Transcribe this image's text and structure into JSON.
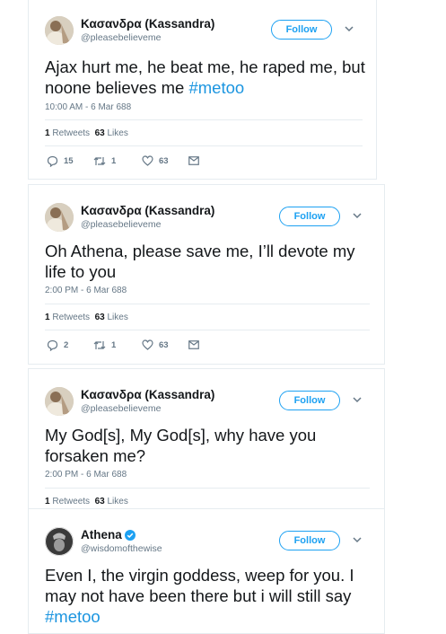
{
  "tweets": [
    {
      "display_name": "Κασανδρα (Kassandra)",
      "handle": "@pleasebelieveme",
      "follow_label": "Follow",
      "text": "Ajax hurt me, he beat me, he raped me, but noone believes me ",
      "hashtag": "#metoo",
      "timestamp": "10:00 AM - 6 Mar 688",
      "retweets_count": "1",
      "retweets_label": "Retweets",
      "likes_count": "63",
      "likes_label": "Likes",
      "reply_count": "15",
      "retweet_action_count": "1",
      "like_action_count": "63"
    },
    {
      "display_name": "Κασανδρα (Kassandra)",
      "handle": "@pleasebelieveme",
      "follow_label": "Follow",
      "text": "Oh Athena, please save me, I’ll devote my life to you",
      "timestamp": "2:00 PM - 6 Mar 688",
      "retweets_count": "1",
      "retweets_label": "Retweets",
      "likes_count": "63",
      "likes_label": "Likes",
      "reply_count": "2",
      "retweet_action_count": "1",
      "like_action_count": "63"
    },
    {
      "display_name": "Κασανδρα (Kassandra)",
      "handle": "@pleasebelieveme",
      "follow_label": "Follow",
      "text": "My God[s], My God[s], why have you forsaken me?",
      "timestamp": "2:00 PM - 6 Mar 688",
      "retweets_count": "1",
      "retweets_label": "Retweets",
      "likes_count": "63",
      "likes_label": "Likes"
    },
    {
      "display_name": "Athena",
      "verified": true,
      "handle": "@wisdomofthewise",
      "follow_label": "Follow",
      "text": "Even I, the virgin goddess, weep for you. I may not have been there but i will still say ",
      "hashtag": "#metoo"
    }
  ],
  "colors": {
    "accent": "#1da1f2",
    "hashtag": "#1b95e0",
    "secondary_text": "#657786",
    "border": "#e6ecf0"
  },
  "icons": [
    "reply-icon",
    "retweet-icon",
    "like-icon",
    "direct-message-icon",
    "chevron-down-icon",
    "verified-badge-icon"
  ]
}
